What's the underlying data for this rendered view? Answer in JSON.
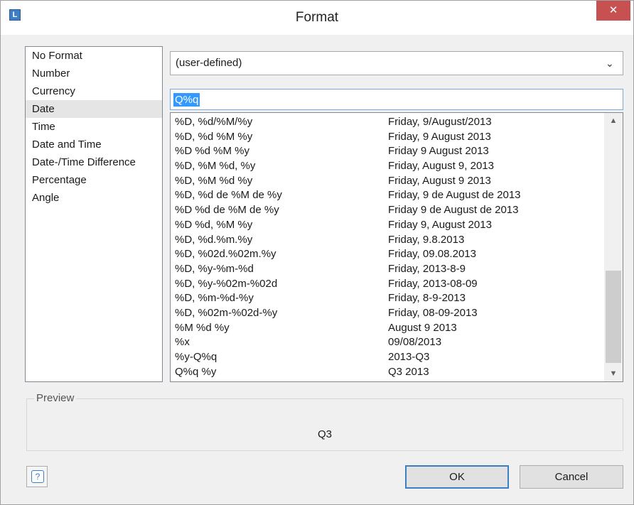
{
  "window": {
    "title": "Format",
    "app_icon": "L",
    "close_label": "✕"
  },
  "categories": [
    {
      "label": "No Format",
      "selected": false
    },
    {
      "label": "Number",
      "selected": false
    },
    {
      "label": "Currency",
      "selected": false
    },
    {
      "label": "Date",
      "selected": true
    },
    {
      "label": "Time",
      "selected": false
    },
    {
      "label": "Date and Time",
      "selected": false
    },
    {
      "label": "Date-/Time Difference",
      "selected": false
    },
    {
      "label": "Percentage",
      "selected": false
    },
    {
      "label": "Angle",
      "selected": false
    }
  ],
  "format_select": {
    "value": "(user-defined)"
  },
  "format_input": {
    "value": "Q%q"
  },
  "formats": [
    {
      "code": "%D, %d/%M/%y",
      "example": "Friday, 9/August/2013"
    },
    {
      "code": "%D, %d %M %y",
      "example": "Friday, 9 August 2013"
    },
    {
      "code": "%D %d %M %y",
      "example": "Friday 9 August 2013"
    },
    {
      "code": "%D, %M %d, %y",
      "example": "Friday, August 9, 2013"
    },
    {
      "code": "%D, %M %d %y",
      "example": "Friday, August 9 2013"
    },
    {
      "code": "%D, %d de %M de %y",
      "example": "Friday, 9 de August de 2013"
    },
    {
      "code": "%D %d de %M de %y",
      "example": "Friday 9 de August de 2013"
    },
    {
      "code": "%D %d, %M %y",
      "example": "Friday 9, August 2013"
    },
    {
      "code": "%D, %d.%m.%y",
      "example": "Friday, 9.8.2013"
    },
    {
      "code": "%D, %02d.%02m.%y",
      "example": "Friday, 09.08.2013"
    },
    {
      "code": "%D, %y-%m-%d",
      "example": "Friday, 2013-8-9"
    },
    {
      "code": "%D, %y-%02m-%02d",
      "example": "Friday, 2013-08-09"
    },
    {
      "code": "%D, %m-%d-%y",
      "example": "Friday, 8-9-2013"
    },
    {
      "code": "%D, %02m-%02d-%y",
      "example": "Friday, 08-09-2013"
    },
    {
      "code": "%M %d %y",
      "example": "August 9 2013"
    },
    {
      "code": "%x",
      "example": "09/08/2013"
    },
    {
      "code": "%y-Q%q",
      "example": "2013-Q3"
    },
    {
      "code": "Q%q %y",
      "example": "Q3 2013"
    }
  ],
  "preview": {
    "label": "Preview",
    "value": "Q3"
  },
  "buttons": {
    "help": "?",
    "ok": "OK",
    "cancel": "Cancel"
  },
  "icons": {
    "scroll_up": "▲",
    "scroll_down": "▼",
    "dropdown": "⌄"
  }
}
